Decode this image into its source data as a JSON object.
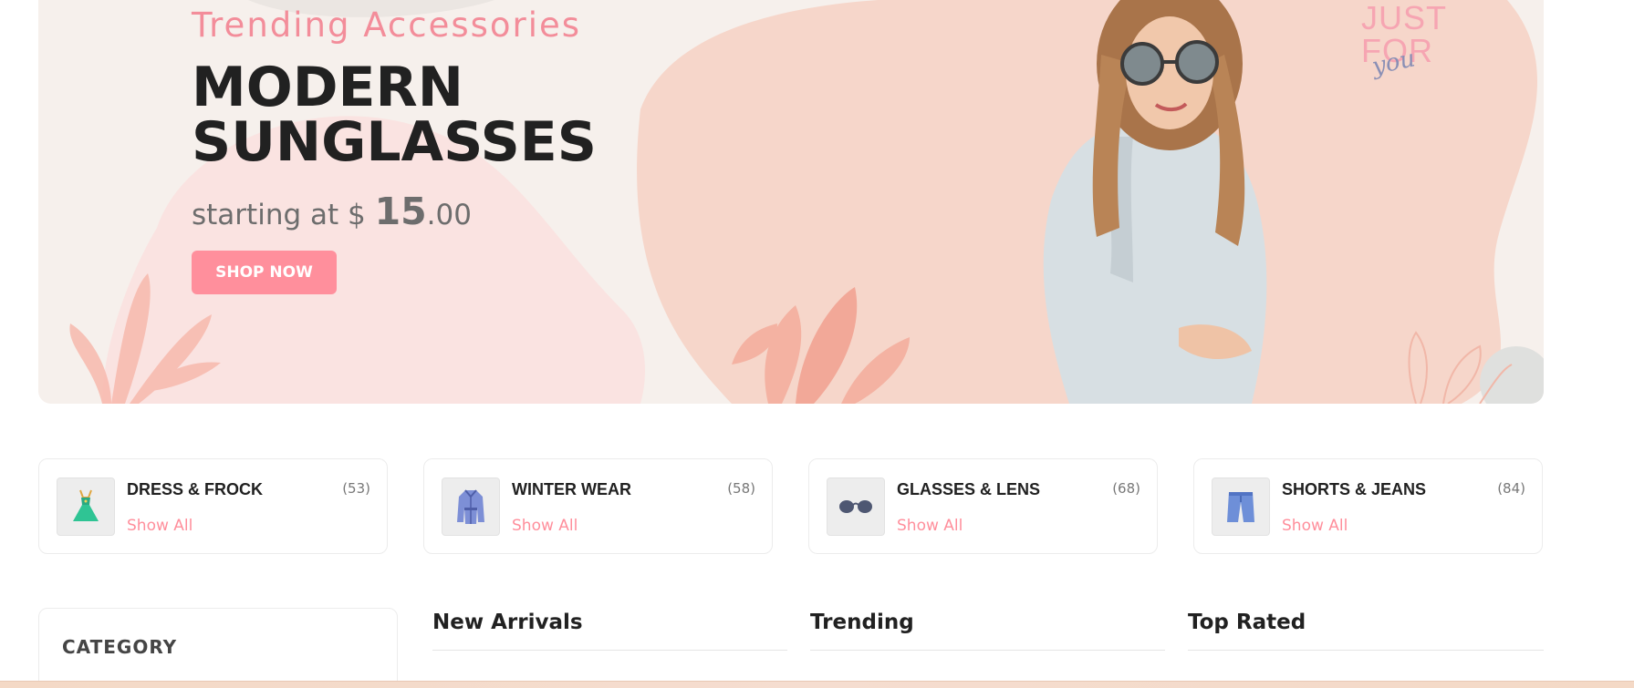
{
  "hero": {
    "subtitle": "Trending Accessories",
    "title": "MODERN SUNGLASSES",
    "price_prefix": "starting at $",
    "price_whole": "15",
    "price_cents": ".00",
    "button_label": "SHOP NOW",
    "tag_line1": "JUST",
    "tag_line2": "FOR",
    "tag_line3": "you"
  },
  "categories": [
    {
      "title": "DRESS & FROCK",
      "count": "(53)",
      "link": "Show All",
      "icon": "dress-icon"
    },
    {
      "title": "WINTER WEAR",
      "count": "(58)",
      "link": "Show All",
      "icon": "coat-icon"
    },
    {
      "title": "GLASSES & LENS",
      "count": "(68)",
      "link": "Show All",
      "icon": "glasses-icon"
    },
    {
      "title": "SHORTS & JEANS",
      "count": "(84)",
      "link": "Show All",
      "icon": "shorts-icon"
    }
  ],
  "sidebar": {
    "category_label": "CATEGORY"
  },
  "columns": [
    {
      "title": "New Arrivals"
    },
    {
      "title": "Trending"
    },
    {
      "title": "Top Rated"
    }
  ],
  "colors": {
    "accent": "#ff8f9c",
    "text": "#212121",
    "muted": "#787878"
  }
}
